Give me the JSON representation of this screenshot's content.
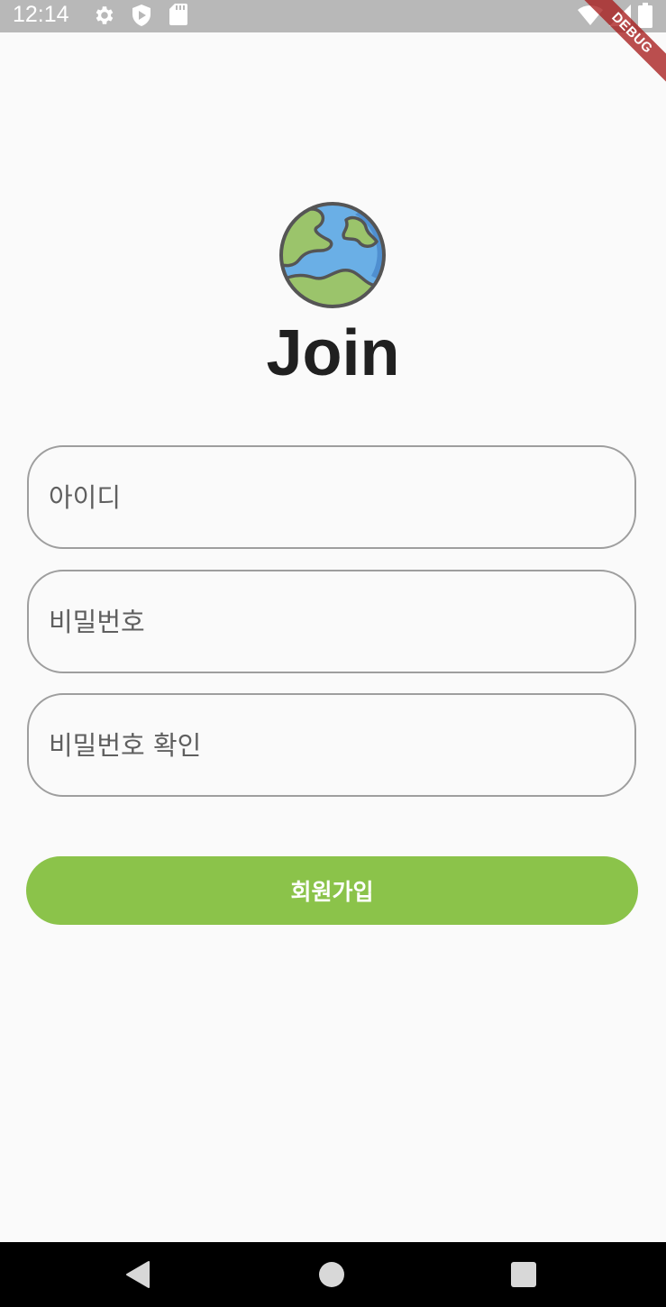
{
  "status_bar": {
    "time": "12:14",
    "icons": [
      "gear-icon",
      "play-protect-icon",
      "sd-card-icon",
      "wifi-icon",
      "signal-icon",
      "battery-icon"
    ]
  },
  "debug_banner": "DEBUG",
  "logo": {
    "icon": "globe-icon"
  },
  "title": "Join",
  "form": {
    "id_placeholder": "아이디",
    "password_placeholder": "비밀번호",
    "password_confirm_placeholder": "비밀번호 확인",
    "submit_label": "회원가입"
  },
  "colors": {
    "accent": "#8bc34a",
    "status_bar": "#b8b8b8",
    "background": "#fafafa",
    "field_border": "#9e9e9e",
    "title": "#202020"
  },
  "nav_bar": {
    "icons": [
      "back-icon",
      "home-icon",
      "recent-apps-icon"
    ]
  }
}
